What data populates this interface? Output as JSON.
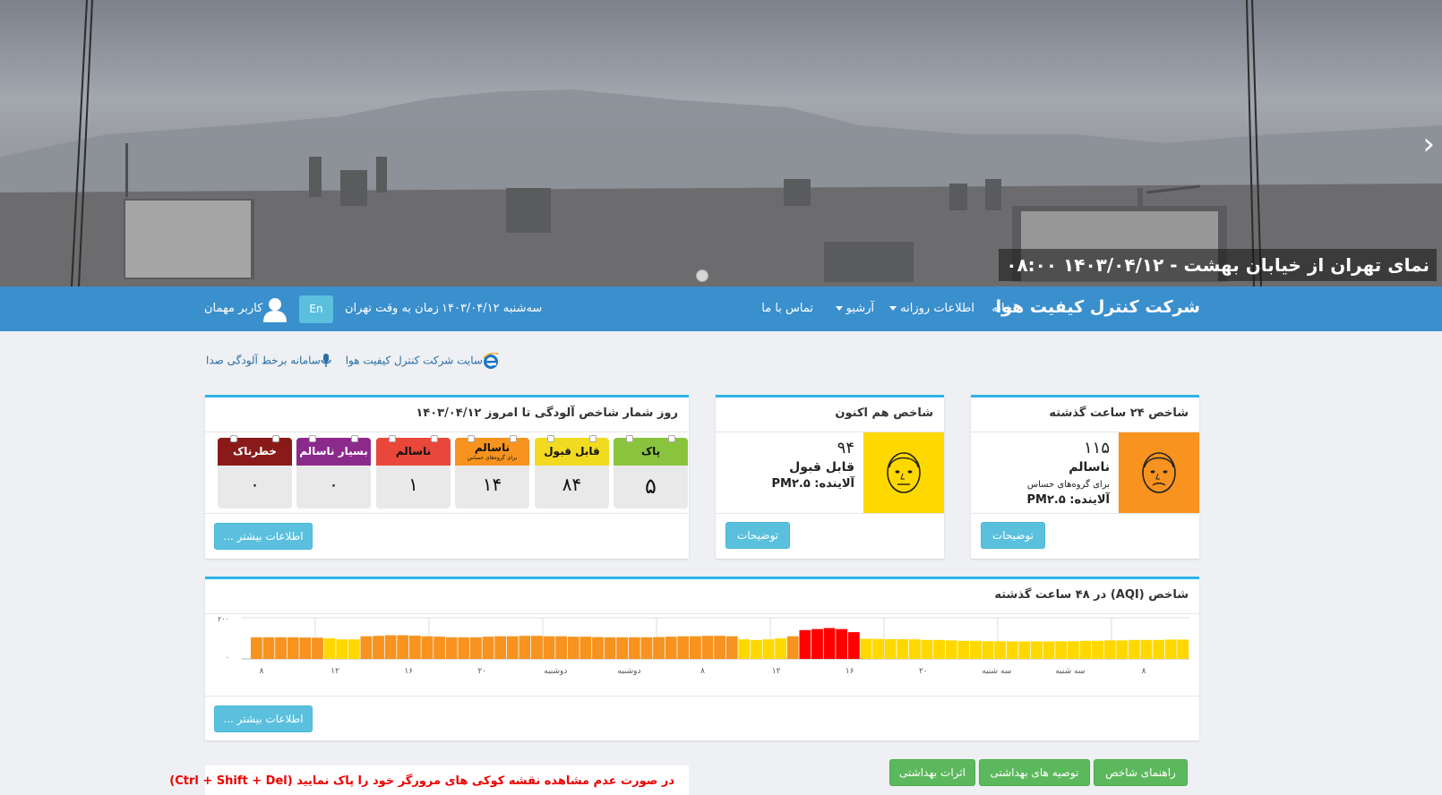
{
  "hero": {
    "caption": "نمای تهران از خیابان بهشت - ۱۴۰۳/۰۴/۱۲ ۰۸:۰۰",
    "next_symbol": "›"
  },
  "nav": {
    "brand": "شرکت کنترل کیفیت هوا",
    "home": "خانه",
    "daily": "اطلاعات روزانه",
    "archive": "آرشیو",
    "contact": "تماس با ما",
    "date": "سه‌شنبه ۱۴۰۳/۰۴/۱۲",
    "tehran_time": "زمان به وقت تهران",
    "lang": "En",
    "user": "کاربر مهمان"
  },
  "links": {
    "company_site": "سایت شرکت کنترل کیفیت هوا",
    "voice_system": "سامانه برخط آلودگی صدا"
  },
  "index24": {
    "title": "شاخص ۲۴ ساعت گذشته",
    "value": "۱۱۵",
    "status": "ناسالم",
    "note": "برای گروه‌های حساس",
    "pollutant": "آلاینده: PM۲.۵",
    "color": "#f7931e",
    "button": "توضیحات"
  },
  "index_now": {
    "title": "شاخص هم اکنون",
    "value": "۹۴",
    "status": "قابل قبول",
    "pollutant": "آلاینده: PM۲.۵",
    "color": "#ffd800",
    "button": "توضیحات"
  },
  "counter": {
    "title": "روز شمار شاخص آلودگی تا امروز ۱۴۰۳/۰۴/۱۲",
    "button": "اطلاعات بیشتر ...",
    "days": [
      {
        "label": "پاک",
        "value": "۵",
        "color": "#8ac43f"
      },
      {
        "label": "قابل قبول",
        "value": "۸۴",
        "color": "#f2da20"
      },
      {
        "label": "ناسالم",
        "sub": "برای گروه‌های حساس",
        "value": "۱۴",
        "color": "#f7931e"
      },
      {
        "label": "ناسالم",
        "value": "۱",
        "color": "#e8473a"
      },
      {
        "label": "بسیار ناسالم",
        "value": "۰",
        "color": "#8c2a8c"
      },
      {
        "label": "خطرناک",
        "value": "۰",
        "color": "#8a1a1a"
      }
    ]
  },
  "aqi48": {
    "title": "شاخص (AQI) در ۴۸ ساعت گذشته",
    "button": "اطلاعات بیشتر ..."
  },
  "chart_data": {
    "type": "bar",
    "ylim": [
      0,
      200
    ],
    "y_ticks": [
      "۰",
      "۲۰۰"
    ],
    "x_tick_labels": [
      "۸",
      "۱۲",
      "۱۶",
      "۲۰",
      "دوشنبه",
      "دوشنبه",
      "۸",
      "۱۲",
      "۱۶",
      "۲۰",
      "سه شنبه",
      "سه شنبه",
      "۸"
    ],
    "values": [
      105,
      105,
      105,
      105,
      104,
      103,
      100,
      95,
      95,
      110,
      112,
      115,
      115,
      113,
      110,
      108,
      105,
      105,
      105,
      108,
      110,
      110,
      112,
      112,
      110,
      110,
      108,
      108,
      106,
      105,
      105,
      105,
      105,
      106,
      108,
      110,
      110,
      112,
      112,
      110,
      95,
      92,
      95,
      100,
      110,
      140,
      145,
      150,
      145,
      130,
      98,
      97,
      96,
      96,
      95,
      92,
      92,
      90,
      88,
      88,
      86,
      86,
      85,
      85,
      85,
      85,
      86,
      86,
      88,
      88,
      90,
      90,
      92,
      92,
      92,
      94,
      94
    ],
    "colors": {
      "acceptable": "#ffd800",
      "sensitive": "#f7931e",
      "unhealthy": "#ff0000"
    }
  },
  "bottom": {
    "guide": "راهنمای شاخص",
    "advice": "توصیه های بهداشتی",
    "effects": "اثرات بهداشتی",
    "notice": "در صورت عدم مشاهده نقشه کوکی های مرورگر خود را پاک نمایید (Ctrl + Shift + Del)"
  }
}
